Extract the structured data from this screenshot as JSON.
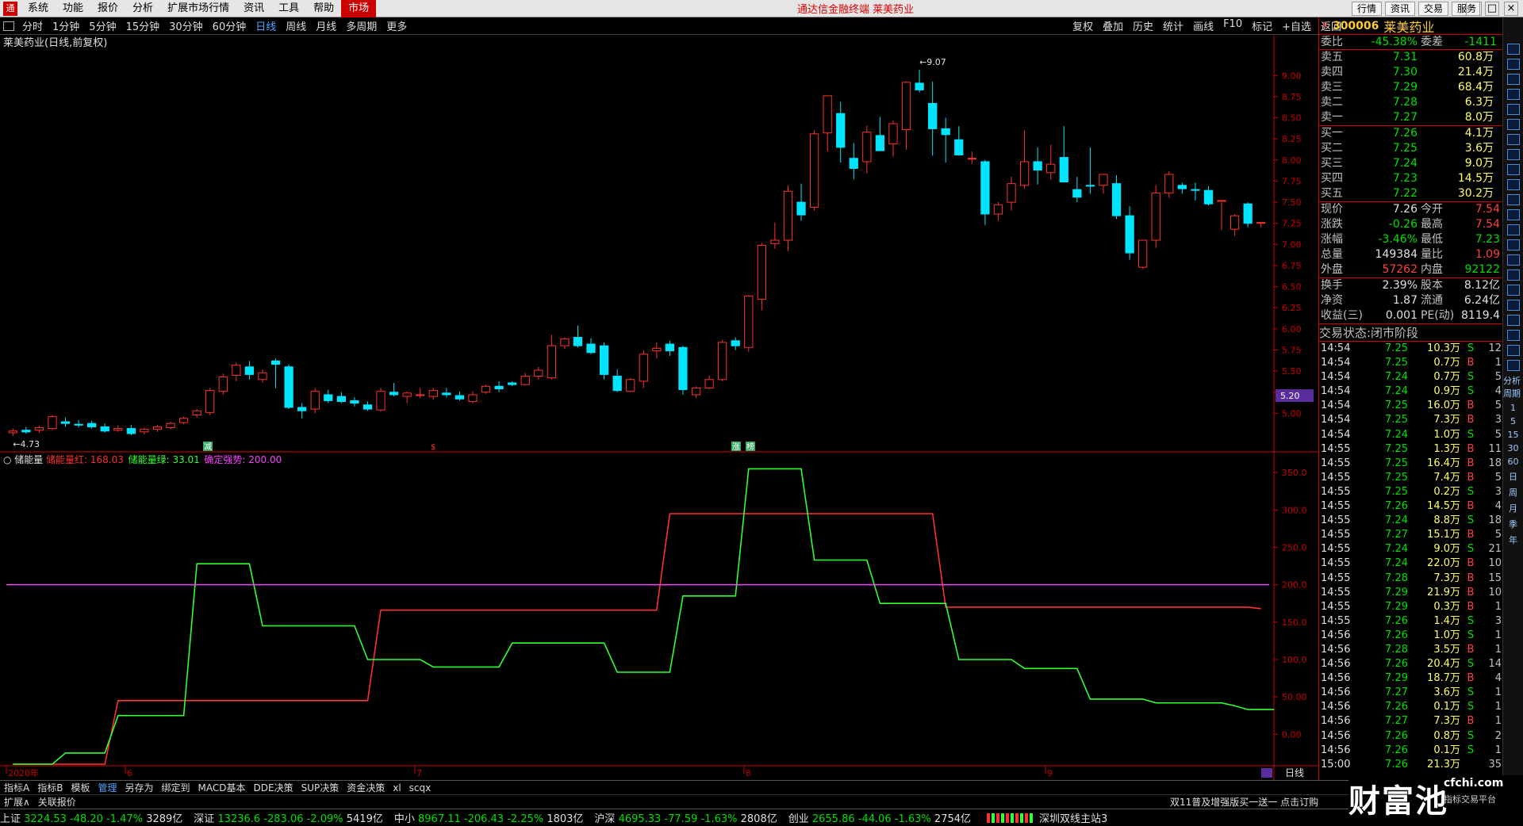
{
  "menubar": {
    "items": [
      "系统",
      "功能",
      "报价",
      "分析",
      "扩展市场行情",
      "资讯",
      "工具",
      "帮助"
    ],
    "active": "市场",
    "center": "通达信金融终端  莱美药业",
    "right": [
      "行情",
      "资讯",
      "交易",
      "服务"
    ]
  },
  "periodbar": {
    "items": [
      "分时",
      "1分钟",
      "5分钟",
      "15分钟",
      "30分钟",
      "60分钟",
      "日线",
      "周线",
      "月线",
      "多周期",
      "更多"
    ],
    "selected": "日线",
    "tools": [
      "复权",
      "叠加",
      "历史",
      "统计",
      "画线",
      "F10",
      "标记",
      "+自选",
      "返回"
    ]
  },
  "main_chart": {
    "title": "莱美药业(日线,前复权)",
    "annot_high": "9.07",
    "annot_low": "4.73",
    "price_marker": "5.20",
    "flags": [
      "减",
      "$",
      "涨",
      "榜"
    ]
  },
  "indicator": {
    "name": "储能量",
    "labels": [
      {
        "text": "储能量红: 168.03",
        "color": "#ff3030"
      },
      {
        "text": "储能量绿: 33.01",
        "color": "#30ff30"
      },
      {
        "text": "确定强势: 200.00",
        "color": "#ff40ff"
      }
    ]
  },
  "x_axis_labels": [
    "2020年",
    "6",
    "7",
    "8",
    "9"
  ],
  "period_label": "日线",
  "chart_data": [
    {
      "type": "candlestick",
      "title": "莱美药业(日线,前复权)",
      "ylim": [
        4.6,
        9.2
      ],
      "y_ticks": [
        "9.00",
        "8.75",
        "8.50",
        "8.25",
        "8.00",
        "7.75",
        "7.50",
        "7.25",
        "7.00",
        "6.75",
        "6.50",
        "6.25",
        "6.00",
        "5.75",
        "5.50",
        "5.25",
        "5.00"
      ],
      "ohlc": [
        [
          4.77,
          4.82,
          4.73,
          4.79
        ],
        [
          4.8,
          4.84,
          4.76,
          4.78
        ],
        [
          4.8,
          4.85,
          4.77,
          4.83
        ],
        [
          4.82,
          4.98,
          4.8,
          4.96
        ],
        [
          4.9,
          4.95,
          4.84,
          4.88
        ],
        [
          4.87,
          4.92,
          4.83,
          4.86
        ],
        [
          4.88,
          4.91,
          4.82,
          4.84
        ],
        [
          4.84,
          4.88,
          4.77,
          4.79
        ],
        [
          4.8,
          4.86,
          4.78,
          4.82
        ],
        [
          4.82,
          4.86,
          4.74,
          4.76
        ],
        [
          4.78,
          4.83,
          4.75,
          4.81
        ],
        [
          4.81,
          4.86,
          4.78,
          4.84
        ],
        [
          4.83,
          4.9,
          4.81,
          4.88
        ],
        [
          4.89,
          4.96,
          4.87,
          4.94
        ],
        [
          4.98,
          5.05,
          4.95,
          5.03
        ],
        [
          5.01,
          5.3,
          4.98,
          5.27
        ],
        [
          5.26,
          5.47,
          5.22,
          5.43
        ],
        [
          5.45,
          5.6,
          5.38,
          5.57
        ],
        [
          5.55,
          5.62,
          5.4,
          5.46
        ],
        [
          5.4,
          5.52,
          5.36,
          5.48
        ],
        [
          5.62,
          5.65,
          5.3,
          5.58
        ],
        [
          5.55,
          5.58,
          5.05,
          5.07
        ],
        [
          5.07,
          5.12,
          4.94,
          5.03
        ],
        [
          5.05,
          5.3,
          5.0,
          5.26
        ],
        [
          5.22,
          5.28,
          5.12,
          5.15
        ],
        [
          5.2,
          5.25,
          5.12,
          5.14
        ],
        [
          5.15,
          5.19,
          5.08,
          5.12
        ],
        [
          5.1,
          5.14,
          5.03,
          5.05
        ],
        [
          5.04,
          5.3,
          5.02,
          5.26
        ],
        [
          5.25,
          5.36,
          5.2,
          5.22
        ],
        [
          5.2,
          5.26,
          5.12,
          5.24
        ],
        [
          5.21,
          5.3,
          5.18,
          5.22
        ],
        [
          5.2,
          5.3,
          5.16,
          5.27
        ],
        [
          5.24,
          5.3,
          5.19,
          5.22
        ],
        [
          5.21,
          5.26,
          5.15,
          5.17
        ],
        [
          5.14,
          5.26,
          5.12,
          5.22
        ],
        [
          5.25,
          5.34,
          5.23,
          5.32
        ],
        [
          5.32,
          5.38,
          5.25,
          5.29
        ],
        [
          5.36,
          5.38,
          5.32,
          5.34
        ],
        [
          5.34,
          5.48,
          5.33,
          5.44
        ],
        [
          5.44,
          5.55,
          5.4,
          5.51
        ],
        [
          5.42,
          5.93,
          5.4,
          5.8
        ],
        [
          5.8,
          5.9,
          5.76,
          5.88
        ],
        [
          5.9,
          6.04,
          5.78,
          5.8
        ],
        [
          5.82,
          5.89,
          5.7,
          5.72
        ],
        [
          5.8,
          5.84,
          5.4,
          5.46
        ],
        [
          5.44,
          5.52,
          5.25,
          5.27
        ],
        [
          5.26,
          5.42,
          5.25,
          5.4
        ],
        [
          5.38,
          5.75,
          5.3,
          5.7
        ],
        [
          5.74,
          5.84,
          5.65,
          5.77
        ],
        [
          5.82,
          5.86,
          5.68,
          5.74
        ],
        [
          5.78,
          5.8,
          5.22,
          5.28
        ],
        [
          5.22,
          5.32,
          5.18,
          5.3
        ],
        [
          5.3,
          5.45,
          5.28,
          5.4
        ],
        [
          5.4,
          5.87,
          5.38,
          5.84
        ],
        [
          5.86,
          5.9,
          5.75,
          5.8
        ],
        [
          5.78,
          6.4,
          5.73,
          6.39
        ],
        [
          6.35,
          7.02,
          6.22,
          6.99
        ],
        [
          7.01,
          7.26,
          6.95,
          7.05
        ],
        [
          7.05,
          7.7,
          6.92,
          7.63
        ],
        [
          7.5,
          7.72,
          7.28,
          7.35
        ],
        [
          7.44,
          8.35,
          7.4,
          8.31
        ],
        [
          8.32,
          8.65,
          8.1,
          8.76
        ],
        [
          8.55,
          8.69,
          7.97,
          8.15
        ],
        [
          8.02,
          8.2,
          7.77,
          7.9
        ],
        [
          7.98,
          8.41,
          7.84,
          8.33
        ],
        [
          8.29,
          8.51,
          8.13,
          8.11
        ],
        [
          8.19,
          8.47,
          8.04,
          8.43
        ],
        [
          8.36,
          8.93,
          8.12,
          8.92
        ],
        [
          8.91,
          9.07,
          8.8,
          8.83
        ],
        [
          8.67,
          8.93,
          8.05,
          8.37
        ],
        [
          8.37,
          8.5,
          7.97,
          8.3
        ],
        [
          8.24,
          8.4,
          8.05,
          8.06
        ],
        [
          8.02,
          8.1,
          7.95,
          8.02
        ],
        [
          7.98,
          8.0,
          7.23,
          7.36
        ],
        [
          7.36,
          7.5,
          7.28,
          7.47
        ],
        [
          7.5,
          7.8,
          7.4,
          7.72
        ],
        [
          7.7,
          8.35,
          7.66,
          7.98
        ],
        [
          7.98,
          8.15,
          7.71,
          7.88
        ],
        [
          7.85,
          8.18,
          7.77,
          7.95
        ],
        [
          8.03,
          8.4,
          7.8,
          7.74
        ],
        [
          7.65,
          7.8,
          7.5,
          7.56
        ],
        [
          7.7,
          8.15,
          7.6,
          7.69
        ],
        [
          7.7,
          7.8,
          7.6,
          7.83
        ],
        [
          7.72,
          7.82,
          7.3,
          7.34
        ],
        [
          7.34,
          7.45,
          6.82,
          6.9
        ],
        [
          6.73,
          7.05,
          6.71,
          7.05
        ],
        [
          7.05,
          7.7,
          6.96,
          7.61
        ],
        [
          7.61,
          7.87,
          7.55,
          7.83
        ],
        [
          7.7,
          7.73,
          7.6,
          7.66
        ],
        [
          7.65,
          7.73,
          7.52,
          7.64
        ],
        [
          7.64,
          7.69,
          7.46,
          7.48
        ],
        [
          7.52,
          7.5,
          7.17,
          7.52
        ],
        [
          7.18,
          7.36,
          7.1,
          7.34
        ],
        [
          7.48,
          7.5,
          7.2,
          7.25
        ],
        [
          7.26,
          7.26,
          7.2,
          7.26
        ]
      ]
    },
    {
      "type": "line",
      "title": "储能量",
      "ylim": [
        -40,
        365
      ],
      "y_ticks": [
        "350.0",
        "300.0",
        "250.0",
        "200.0",
        "150.0",
        "100.0",
        "50.00",
        "0.00"
      ],
      "series": [
        {
          "name": "储能量红",
          "color": "#ff3030",
          "values": [
            -40,
            -40,
            -40,
            -40,
            -40,
            -40,
            -40,
            -40,
            45,
            45,
            45,
            45,
            45,
            45,
            45,
            45,
            45,
            45,
            45,
            45,
            45,
            45,
            45,
            45,
            45,
            45,
            45,
            45,
            166,
            166,
            166,
            166,
            166,
            166,
            166,
            166,
            166,
            166,
            166,
            166,
            166,
            166,
            166,
            166,
            166,
            166,
            166,
            166,
            166,
            166,
            295,
            295,
            295,
            295,
            295,
            295,
            295,
            295,
            295,
            295,
            295,
            295,
            295,
            295,
            295,
            295,
            295,
            295,
            295,
            295,
            295,
            170,
            170,
            170,
            170,
            170,
            170,
            170,
            170,
            170,
            170,
            170,
            170,
            170,
            170,
            170,
            170,
            170,
            170,
            170,
            170,
            170,
            170,
            170,
            170,
            168
          ]
        },
        {
          "name": "储能量绿",
          "color": "#30ff30",
          "values": [
            -40,
            -40,
            -40,
            -40,
            -25,
            -25,
            -25,
            -25,
            25,
            25,
            25,
            25,
            25,
            25,
            228,
            228,
            228,
            228,
            228,
            145,
            145,
            145,
            145,
            145,
            145,
            145,
            145,
            100,
            100,
            100,
            100,
            100,
            90,
            90,
            90,
            90,
            90,
            90,
            122,
            122,
            122,
            122,
            122,
            122,
            122,
            122,
            83,
            83,
            83,
            83,
            83,
            185,
            185,
            185,
            185,
            185,
            355,
            355,
            355,
            355,
            355,
            233,
            233,
            233,
            233,
            233,
            175,
            175,
            175,
            175,
            175,
            175,
            100,
            100,
            100,
            100,
            100,
            88,
            88,
            88,
            88,
            88,
            47,
            47,
            47,
            47,
            47,
            42,
            42,
            42,
            42,
            42,
            42,
            38,
            33,
            33,
            33
          ]
        },
        {
          "name": "确定强势",
          "color": "#ff40ff",
          "values": [
            200
          ]
        }
      ]
    }
  ],
  "quote": {
    "code": "300006",
    "name": "莱美药业",
    "wb": {
      "label": "委比",
      "ratio": "-45.38%",
      "wc_label": "委差",
      "wc": "-1411"
    },
    "asks": [
      {
        "label": "卖五",
        "price": "7.31",
        "vol": "60.8万"
      },
      {
        "label": "卖四",
        "price": "7.30",
        "vol": "21.4万"
      },
      {
        "label": "卖三",
        "price": "7.29",
        "vol": "68.4万"
      },
      {
        "label": "卖二",
        "price": "7.28",
        "vol": "6.3万"
      },
      {
        "label": "卖一",
        "price": "7.27",
        "vol": "8.0万"
      }
    ],
    "bids": [
      {
        "label": "买一",
        "price": "7.26",
        "vol": "4.1万"
      },
      {
        "label": "买二",
        "price": "7.25",
        "vol": "3.6万"
      },
      {
        "label": "买三",
        "price": "7.24",
        "vol": "9.0万"
      },
      {
        "label": "买四",
        "price": "7.23",
        "vol": "14.5万"
      },
      {
        "label": "买五",
        "price": "7.22",
        "vol": "30.2万"
      }
    ],
    "stats": [
      {
        "l1": "现价",
        "v1": "7.26",
        "l2": "今开",
        "v2": "7.54"
      },
      {
        "l1": "涨跌",
        "v1": "-0.26",
        "l2": "最高",
        "v2": "7.54"
      },
      {
        "l1": "涨幅",
        "v1": "-3.46%",
        "l2": "最低",
        "v2": "7.23"
      },
      {
        "l1": "总量",
        "v1": "149384",
        "l2": "量比",
        "v2": "1.09"
      },
      {
        "l1": "外盘",
        "v1": "57262",
        "l2": "内盘",
        "v2": "92122"
      }
    ],
    "stats2": [
      {
        "l1": "换手",
        "v1": "2.39%",
        "l2": "股本",
        "v2": "8.12亿"
      },
      {
        "l1": "净资",
        "v1": "1.87",
        "l2": "流通",
        "v2": "6.24亿"
      },
      {
        "l1": "收益(三)",
        "v1": "0.001",
        "l2": "PE(动)",
        "v2": "8119.4"
      }
    ],
    "trade_status": "交易状态:闭市阶段",
    "ticks": [
      [
        "14:54",
        "7.25",
        "10.3万",
        "S",
        "12"
      ],
      [
        "14:54",
        "7.25",
        "0.7万",
        "B",
        "1"
      ],
      [
        "14:54",
        "7.24",
        "0.7万",
        "S",
        "5"
      ],
      [
        "14:54",
        "7.24",
        "0.9万",
        "S",
        "4"
      ],
      [
        "14:54",
        "7.25",
        "16.0万",
        "B",
        "5"
      ],
      [
        "14:54",
        "7.25",
        "7.3万",
        "B",
        "3"
      ],
      [
        "14:54",
        "7.24",
        "1.0万",
        "S",
        "5"
      ],
      [
        "14:55",
        "7.25",
        "1.3万",
        "B",
        "11"
      ],
      [
        "14:55",
        "7.25",
        "16.4万",
        "B",
        "18"
      ],
      [
        "14:55",
        "7.25",
        "7.4万",
        "B",
        "5"
      ],
      [
        "14:55",
        "7.25",
        "0.2万",
        "S",
        "3"
      ],
      [
        "14:55",
        "7.26",
        "14.5万",
        "B",
        "4"
      ],
      [
        "14:55",
        "7.24",
        "8.8万",
        "S",
        "18"
      ],
      [
        "14:55",
        "7.27",
        "15.1万",
        "B",
        "5"
      ],
      [
        "14:55",
        "7.24",
        "9.0万",
        "S",
        "21"
      ],
      [
        "14:55",
        "7.24",
        "22.0万",
        "B",
        "10"
      ],
      [
        "14:55",
        "7.28",
        "7.3万",
        "B",
        "15"
      ],
      [
        "14:55",
        "7.29",
        "21.9万",
        "B",
        "10"
      ],
      [
        "14:55",
        "7.29",
        "0.3万",
        "B",
        "1"
      ],
      [
        "14:55",
        "7.26",
        "1.4万",
        "S",
        "3"
      ],
      [
        "14:56",
        "7.26",
        "1.0万",
        "S",
        "1"
      ],
      [
        "14:56",
        "7.28",
        "3.5万",
        "B",
        "1"
      ],
      [
        "14:56",
        "7.26",
        "20.4万",
        "S",
        "14"
      ],
      [
        "14:56",
        "7.29",
        "18.7万",
        "B",
        "4"
      ],
      [
        "14:56",
        "7.27",
        "3.6万",
        "S",
        "1"
      ],
      [
        "14:56",
        "7.26",
        "0.1万",
        "S",
        "1"
      ],
      [
        "14:56",
        "7.27",
        "7.3万",
        "B",
        "1"
      ],
      [
        "14:56",
        "7.26",
        "0.8万",
        "S",
        "2"
      ],
      [
        "14:56",
        "7.26",
        "0.1万",
        "S",
        "1"
      ],
      [
        "15:00",
        "7.26",
        "21.3万",
        "",
        "35"
      ]
    ]
  },
  "side_labels": [
    "分析周期",
    "1",
    "5",
    "15",
    "30",
    "60",
    "日",
    "周",
    "月",
    "季",
    "年"
  ],
  "bottom_tabs": [
    "指标A",
    "指标B",
    "模板",
    "管理",
    "另存为",
    "绑定到",
    "MACD基本",
    "DDE决策",
    "SUP决策",
    "资金决策",
    "xl",
    "scqx"
  ],
  "bottom_tabs_selected": "管理",
  "bottom2": [
    "扩展∧",
    "关联报价"
  ],
  "news": "双11普及增强版买一送一 点击订购",
  "indices": [
    {
      "name": "上证",
      "val": "3224.53",
      "chg": "-48.20",
      "pct": "-1.47%",
      "amt": "3289亿"
    },
    {
      "name": "深证",
      "val": "13236.6",
      "chg": "-283.06",
      "pct": "-2.09%",
      "amt": "5419亿"
    },
    {
      "name": "中小",
      "val": "8967.11",
      "chg": "-206.43",
      "pct": "-2.25%",
      "amt": "1803亿"
    },
    {
      "name": "沪深",
      "val": "4695.33",
      "chg": "-77.59",
      "pct": "-1.63%",
      "amt": "2808亿"
    },
    {
      "name": "创业",
      "val": "2655.86",
      "chg": "-44.06",
      "pct": "-1.63%",
      "amt": "2754亿"
    }
  ],
  "station": "深圳双线主站3",
  "brand": {
    "big": "财富池",
    "site": "cfchi.com",
    "sub": "指标交易平台"
  }
}
